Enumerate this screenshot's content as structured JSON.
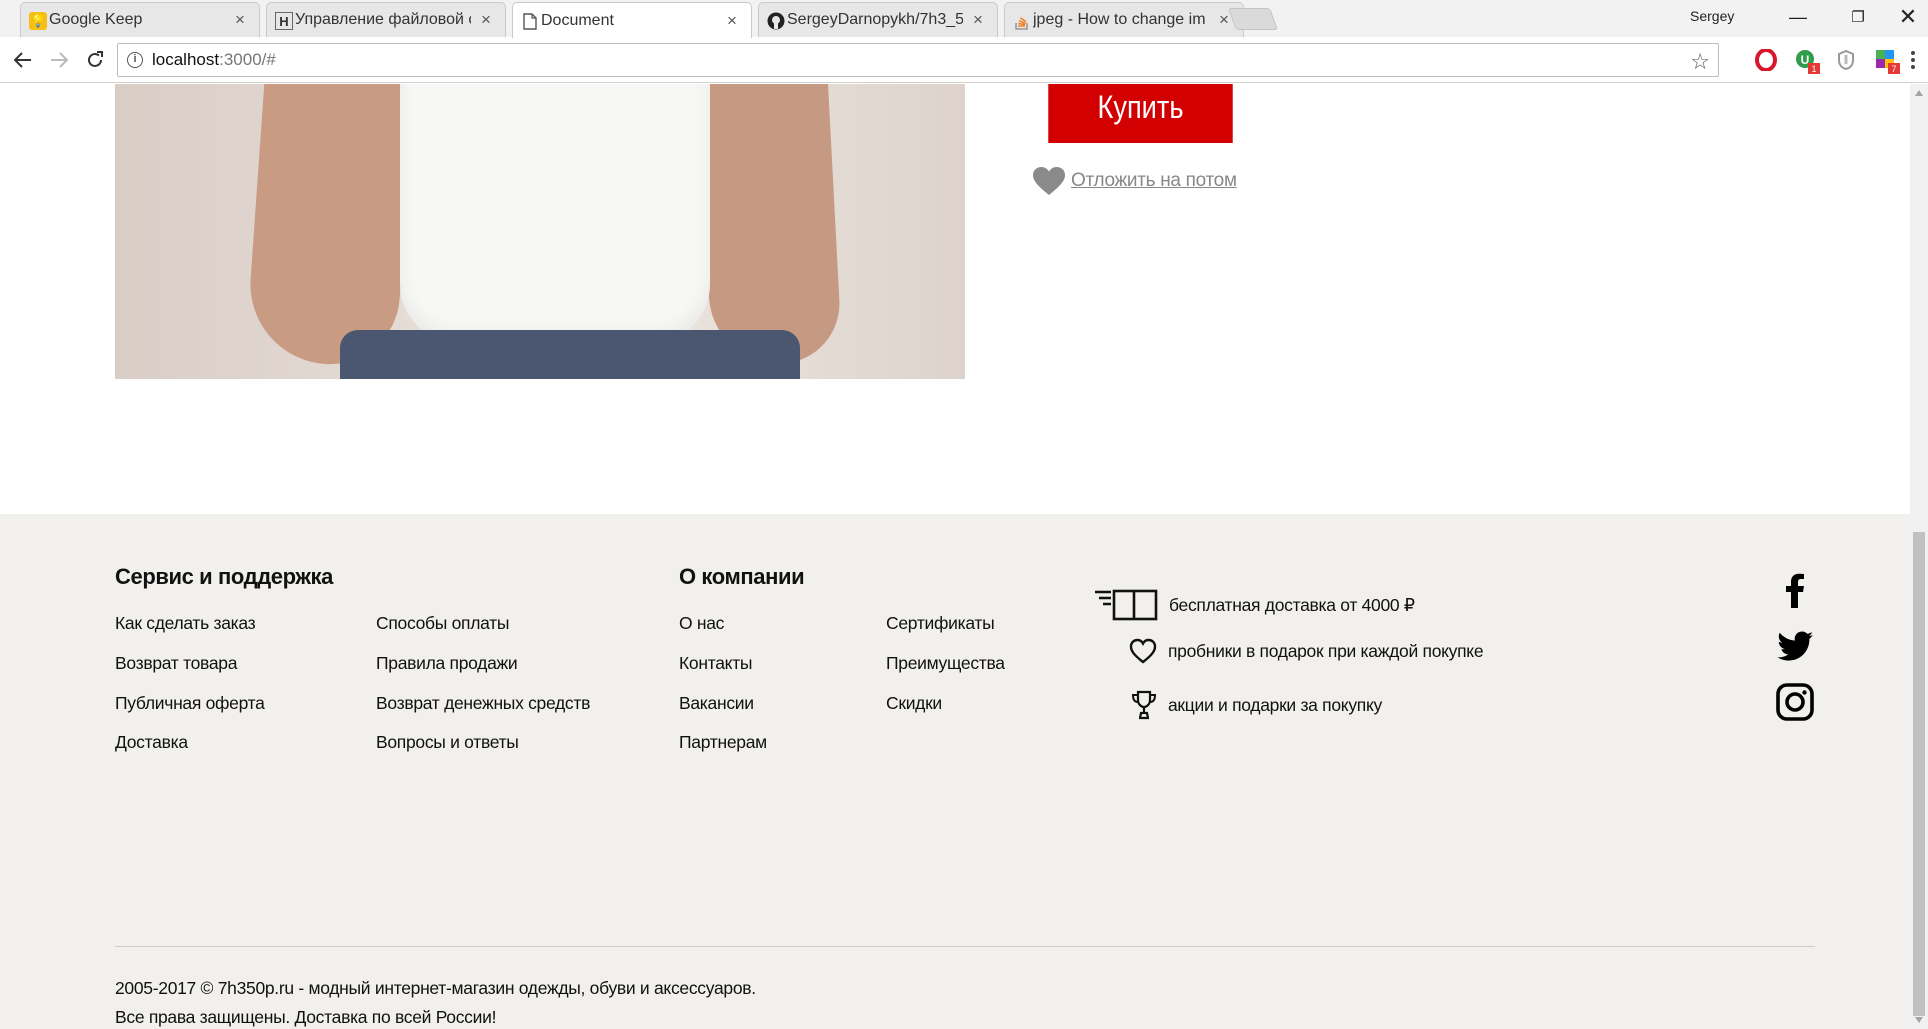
{
  "browser": {
    "tabs": [
      {
        "title": "Google Keep",
        "icon": "google-keep-icon"
      },
      {
        "title": "Управление файловой с",
        "icon": "habr-icon"
      },
      {
        "title": "Document",
        "icon": "document-icon"
      },
      {
        "title": "SergeyDarnopykh/7h3_5",
        "icon": "github-icon"
      },
      {
        "title": "jpeg - How to change im",
        "icon": "stackoverflow-icon"
      }
    ],
    "profile_name": "Sergey",
    "url_host": "localhost",
    "url_path": ":3000/#",
    "extension_badges": [
      "1",
      "7"
    ]
  },
  "product": {
    "buy_label": "Купить",
    "wishlist_label": "Отложить на потом"
  },
  "footer": {
    "service": {
      "title": "Сервис и поддержка",
      "col1": [
        "Как сделать заказ",
        "Возврат товара",
        "Публичная оферта",
        "Доставка"
      ],
      "col2": [
        "Способы оплаты",
        "Правила продажи",
        "Возврат денежных средств",
        "Вопросы и ответы"
      ]
    },
    "company": {
      "title": "О компании",
      "col1": [
        "О нас",
        "Контакты",
        "Вакансии",
        "Партнерам"
      ],
      "col2": [
        "Сертификаты",
        "Преимущества",
        "Скидки"
      ]
    },
    "features": [
      {
        "icon": "delivery-icon",
        "text": "бесплатная доставка от 4000 ₽"
      },
      {
        "icon": "heart-outline-icon",
        "text": "пробники в подарок при каждой покупке"
      },
      {
        "icon": "trophy-icon",
        "text": "акции и подарки за покупку"
      }
    ],
    "social": [
      "facebook-icon",
      "twitter-icon",
      "instagram-icon"
    ],
    "copyright_line1": "2005-2017 © 7h350p.ru - модный интернет-магазин одежды, обуви и аксессуаров.",
    "copyright_line2": "Все права защищены. Доставка по всей России!"
  },
  "colors": {
    "buy_button": "#d20000",
    "footer_bg": "#f1f0ec",
    "wishlist_text": "#888888"
  }
}
